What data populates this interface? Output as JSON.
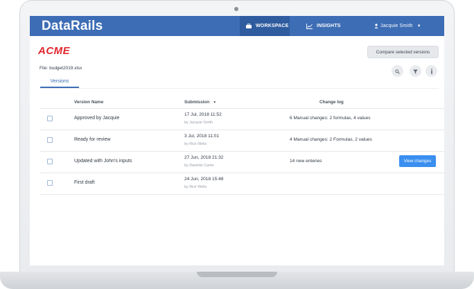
{
  "app": {
    "brand": "DataRails",
    "company_logo": "ACME"
  },
  "nav": {
    "workspace": {
      "label": "WORKSPACE",
      "icon": "briefcase-icon"
    },
    "insights": {
      "label": "INSIGHTS",
      "icon": "line-chart-icon"
    },
    "user": {
      "label": "Jacquie Smith",
      "icon": "person-icon"
    }
  },
  "toolbar": {
    "compare_label": "Compare selected versions",
    "file_label": "File: budget2019.xlsx",
    "icons": [
      "search-icon",
      "filter-icon",
      "info-icon"
    ]
  },
  "tabs": {
    "versions": "Versions"
  },
  "table": {
    "headers": {
      "name": "Version Name",
      "submission": "Submission",
      "change_log": "Change log"
    },
    "rows": [
      {
        "name": "Approved by Jacquie",
        "date": "17 Jul, 2018 11:52",
        "by": "by Jacquie Smith",
        "changes": "6 Manual changes: 2 formulas, 4 values"
      },
      {
        "name": "Ready for review",
        "date": "3 Jul, 2018 11:01",
        "by": "by Rick Wells",
        "changes": "4 Manual changes: 2 Formulas, 2 values"
      },
      {
        "name": "Updated with John's inputs",
        "date": "27 Jun, 2018 21:32",
        "by": "by Danielle Carter",
        "changes": "14 new enteries",
        "action": "View changes"
      },
      {
        "name": "First draft",
        "date": "24 Jun, 2018 15:48",
        "by": "by Rick Wells",
        "changes": ""
      }
    ]
  },
  "colors": {
    "topbar": "#3d6db5",
    "accent": "#3a8ff0",
    "logo_red": "#e0262d"
  }
}
